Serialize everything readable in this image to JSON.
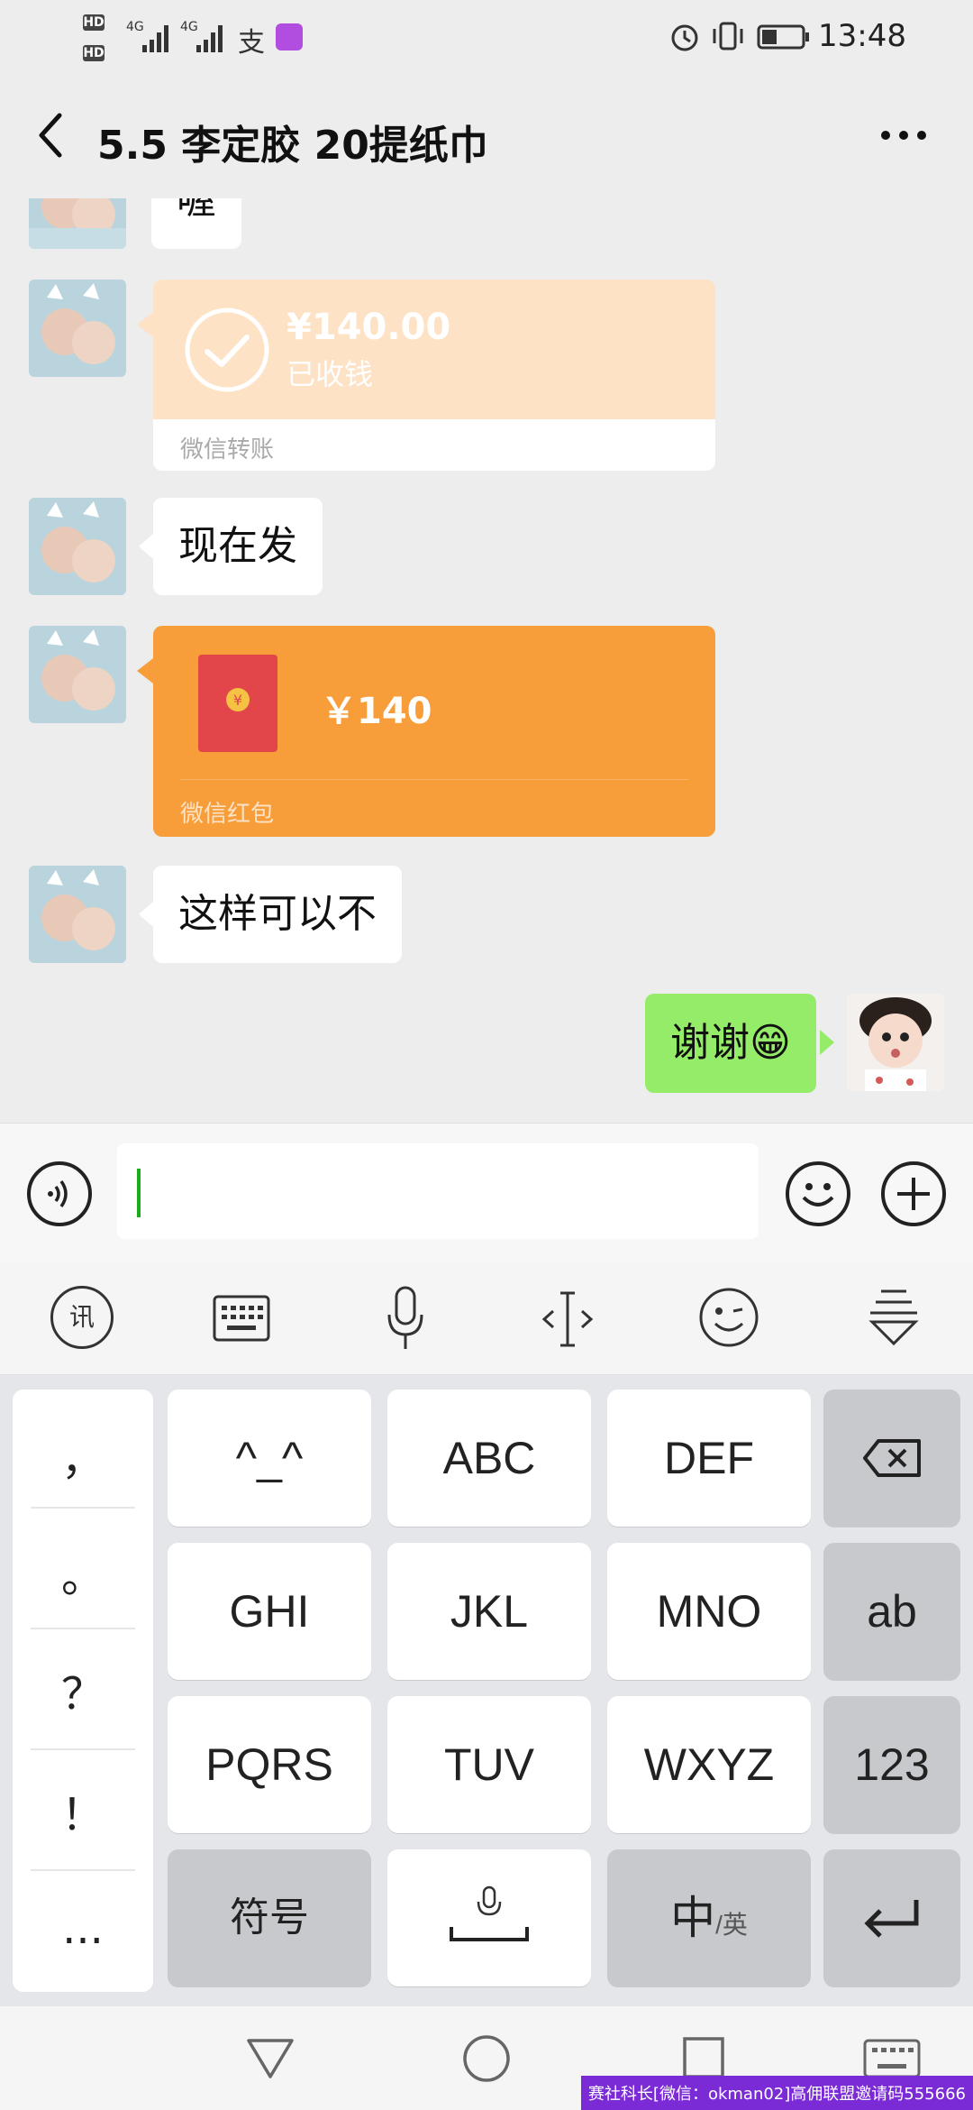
{
  "status_bar": {
    "hd1": "HD",
    "hd2": "HD",
    "net1": "4G",
    "net2": "4G",
    "time": "13:48",
    "icons": [
      "alarm-icon",
      "vibrate-icon",
      "battery-icon",
      "alipay-icon",
      "app-icon"
    ]
  },
  "header": {
    "title": "5.5 李定胶 20提纸巾",
    "back_icon": "chevron-left-icon",
    "more_icon": "more-dots-icon"
  },
  "messages": {
    "partial_text": "喔",
    "transfer": {
      "amount": "¥140.00",
      "status": "已收钱",
      "footer": "微信转账"
    },
    "text1": "现在发",
    "red_packet": {
      "amount": "￥140",
      "footer": "微信红包"
    },
    "text2": "这样可以不",
    "mine": "谢谢😁"
  },
  "input_bar": {
    "voice_icon": "voice-icon",
    "emoji_icon": "emoji-icon",
    "plus_icon": "plus-icon",
    "value": ""
  },
  "ime_toolbar": {
    "icons": [
      "xunfei-logo-icon",
      "keyboard-icon",
      "mic-icon",
      "cursor-move-icon",
      "wink-emoji-icon",
      "collapse-keyboard-icon"
    ]
  },
  "keyboard": {
    "punct": [
      "，",
      "。",
      "？",
      "！",
      "..."
    ],
    "row1": [
      "^_^",
      "ABC",
      "DEF"
    ],
    "row2": [
      "GHI",
      "JKL",
      "MNO",
      "ab"
    ],
    "row3": [
      "PQRS",
      "TUV",
      "WXYZ",
      "123"
    ],
    "row4": {
      "symbols": "符号",
      "lang_main": "中",
      "lang_sub": "/英"
    }
  },
  "nav_bar": {
    "watermark": "赛社科长[微信：okman02]高佣联盟邀请码555666"
  }
}
